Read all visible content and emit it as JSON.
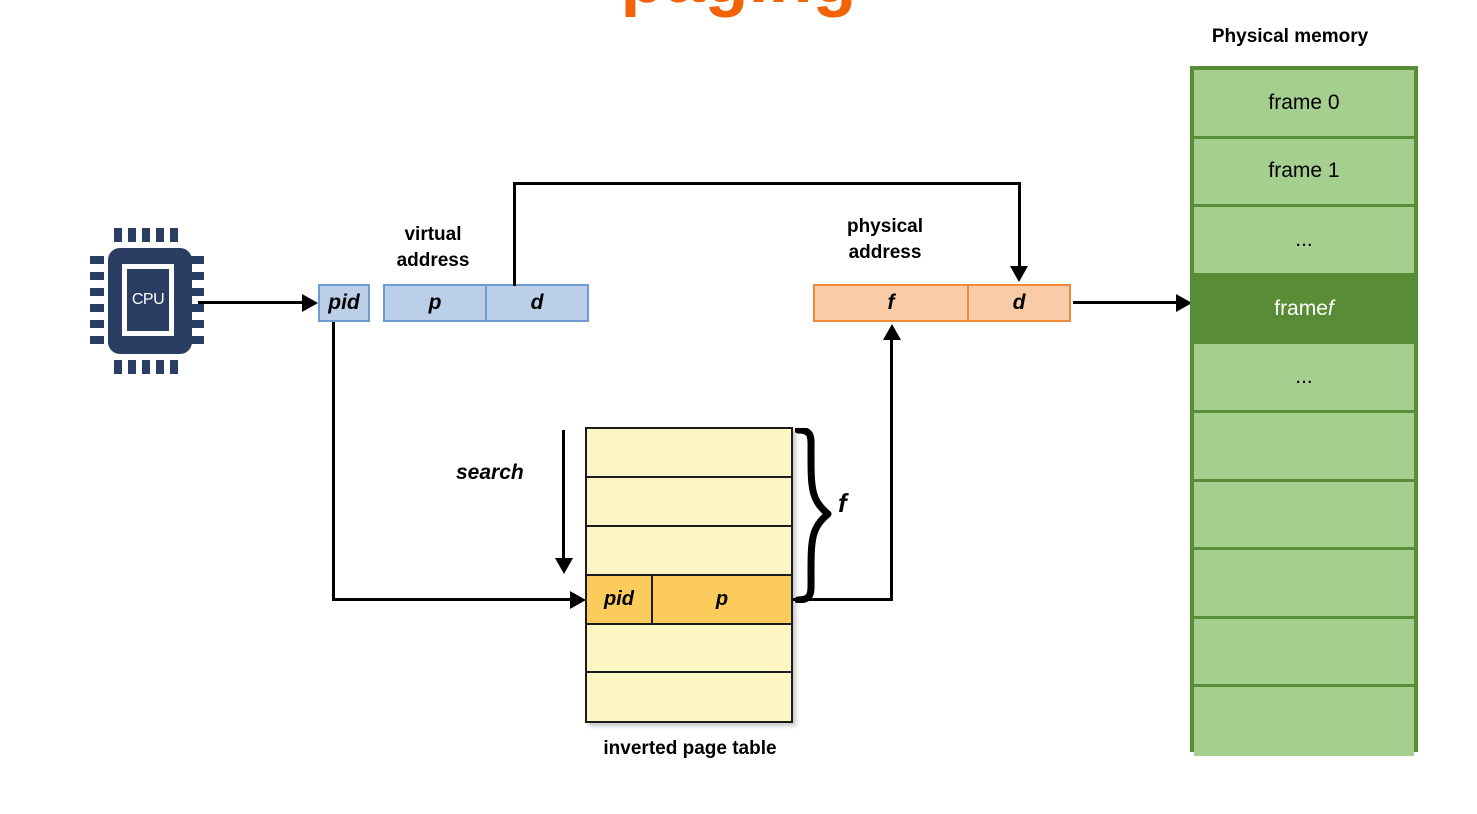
{
  "title_fragment": "paging",
  "cpu": {
    "label": "CPU",
    "icon": "cpu-chip-icon"
  },
  "virtual_address": {
    "caption": "virtual\naddress",
    "pid_label": "pid",
    "page_label": "p",
    "offset_label": "d"
  },
  "physical_address": {
    "caption": "physical\naddress",
    "frame_label": "f",
    "offset_label": "d"
  },
  "page_table": {
    "caption": "inverted page table",
    "search_label": "search",
    "brace_label": "f",
    "rows": [
      {
        "pid": "",
        "p": "",
        "highlight": false
      },
      {
        "pid": "",
        "p": "",
        "highlight": false
      },
      {
        "pid": "",
        "p": "",
        "highlight": false
      },
      {
        "pid": "pid",
        "p": "p",
        "highlight": true
      },
      {
        "pid": "",
        "p": "",
        "highlight": false
      },
      {
        "pid": "",
        "p": "",
        "highlight": false
      }
    ]
  },
  "physical_memory": {
    "title": "Physical memory",
    "rows": [
      {
        "label": "frame 0",
        "italic_suffix": "",
        "highlight": false
      },
      {
        "label": "frame 1",
        "italic_suffix": "",
        "highlight": false
      },
      {
        "label": "...",
        "italic_suffix": "",
        "highlight": false
      },
      {
        "label": "frame ",
        "italic_suffix": "f",
        "highlight": true
      },
      {
        "label": "...",
        "italic_suffix": "",
        "highlight": false
      },
      {
        "label": "",
        "italic_suffix": "",
        "highlight": false
      },
      {
        "label": "",
        "italic_suffix": "",
        "highlight": false
      },
      {
        "label": "",
        "italic_suffix": "",
        "highlight": false
      },
      {
        "label": "",
        "italic_suffix": "",
        "highlight": false
      },
      {
        "label": "",
        "italic_suffix": "",
        "highlight": false
      }
    ]
  },
  "colors": {
    "title_orange": "#F26307",
    "cpu_navy": "#2A3D63",
    "virtual_fill": "#BCCFE8",
    "virtual_border": "#6E9BD1",
    "physical_fill": "#F9CBA7",
    "physical_border": "#ED8A3C",
    "table_fill": "#FDF5C3",
    "table_highlight": "#FBCB5C",
    "memory_fill": "#A5CF8E",
    "memory_border": "#588C36",
    "line": "#000000"
  }
}
